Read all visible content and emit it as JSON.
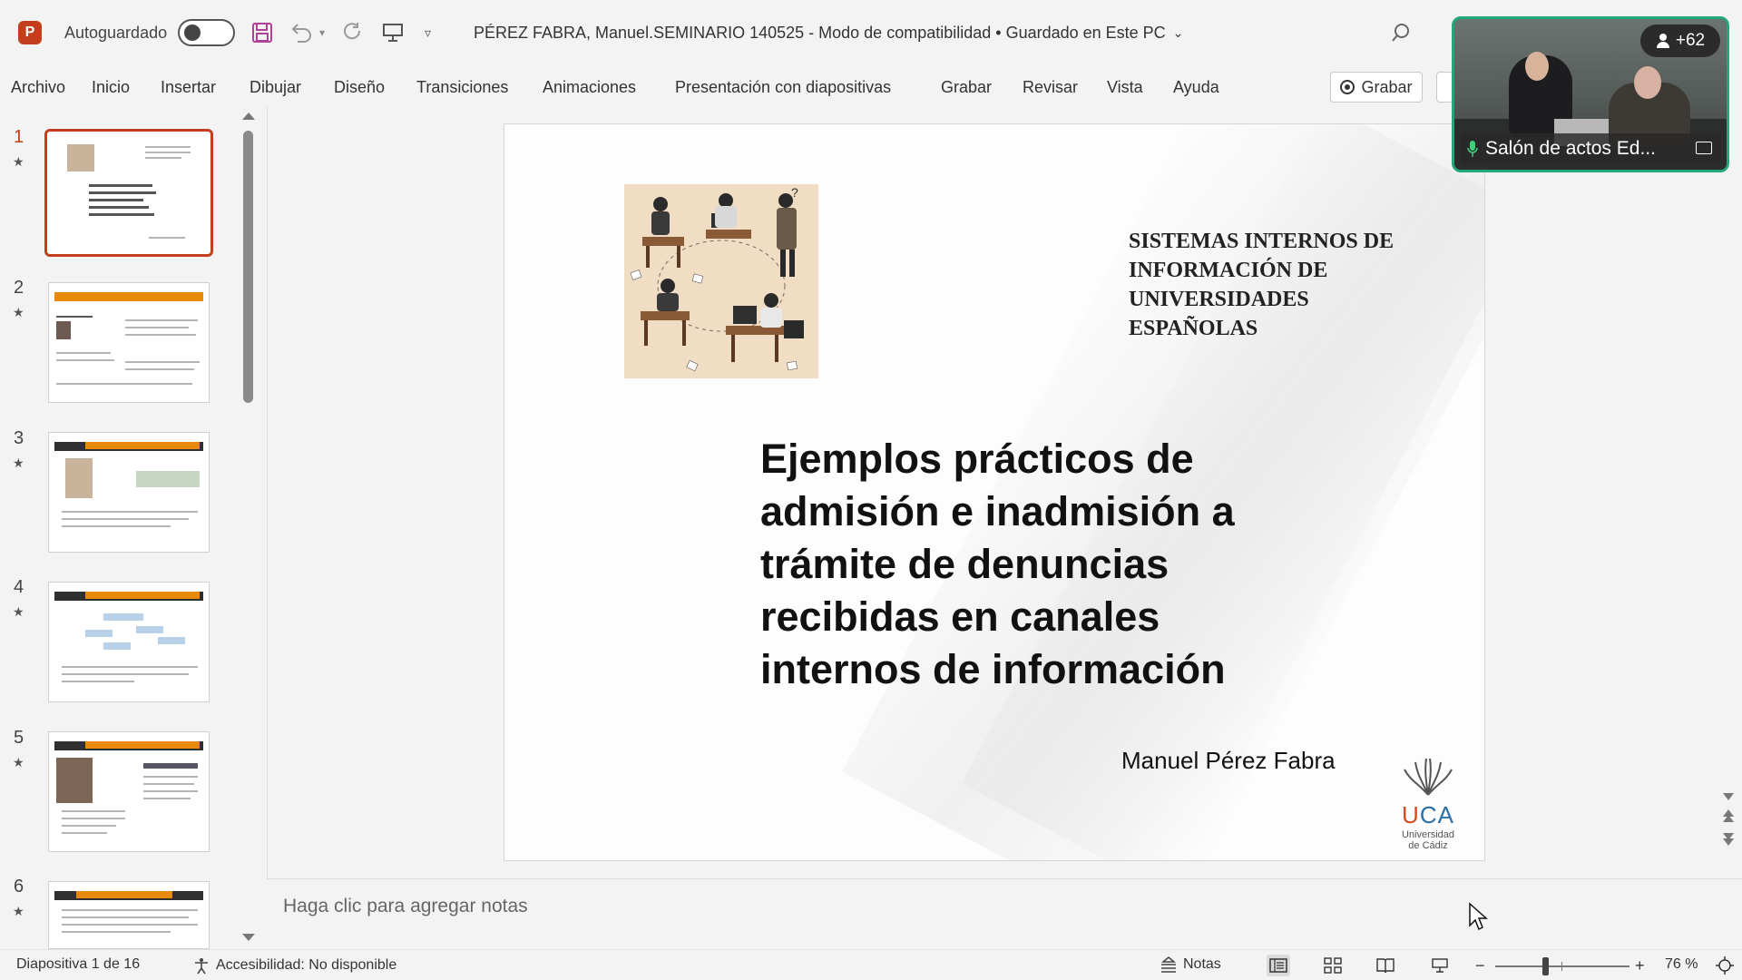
{
  "app": {
    "icon_letter": "P",
    "accent_color": "#c43e1c",
    "autosave_label": "Autoguardado",
    "autosave_state": "off",
    "doc_title": "PÉREZ FABRA, Manuel.SEMINARIO 140525  -  Modo de compatibilidad  •  Guardado en Este PC"
  },
  "ribbon": {
    "tabs": [
      "Archivo",
      "Inicio",
      "Insertar",
      "Dibujar",
      "Diseño",
      "Transiciones",
      "Animaciones",
      "Presentación con diapositivas",
      "Grabar",
      "Revisar",
      "Vista",
      "Ayuda"
    ],
    "record_button": "Grabar"
  },
  "thumbnails": [
    {
      "number": "1",
      "star": "★"
    },
    {
      "number": "2",
      "star": "★"
    },
    {
      "number": "3",
      "star": "★"
    },
    {
      "number": "4",
      "star": "★"
    },
    {
      "number": "5",
      "star": "★"
    },
    {
      "number": "6",
      "star": "★"
    }
  ],
  "slide": {
    "subtitle": "SISTEMAS INTERNOS DE\nINFORMACIÓN DE\nUNIVERSIDADES\nESPAÑOLAS",
    "title": "Ejemplos prácticos de\nadmisión e inadmisión a\ntrámite de denuncias\nrecibidas en canales\ninternos de información",
    "author": "Manuel Pérez Fabra",
    "logo_u": "U",
    "logo_ca": "CA",
    "logo_sub": "Universidad\nde Cádiz"
  },
  "notes": {
    "placeholder": "Haga clic para agregar notas"
  },
  "status": {
    "slide_counter": "Diapositiva 1 de 16",
    "accessibility": "Accesibilidad: No disponible",
    "notes_label": "Notas",
    "zoom_minus": "−",
    "zoom_plus": "+",
    "zoom_level": "76 %"
  },
  "video": {
    "participants_count": "+62",
    "room_label": "Salón de actos Ed..."
  }
}
